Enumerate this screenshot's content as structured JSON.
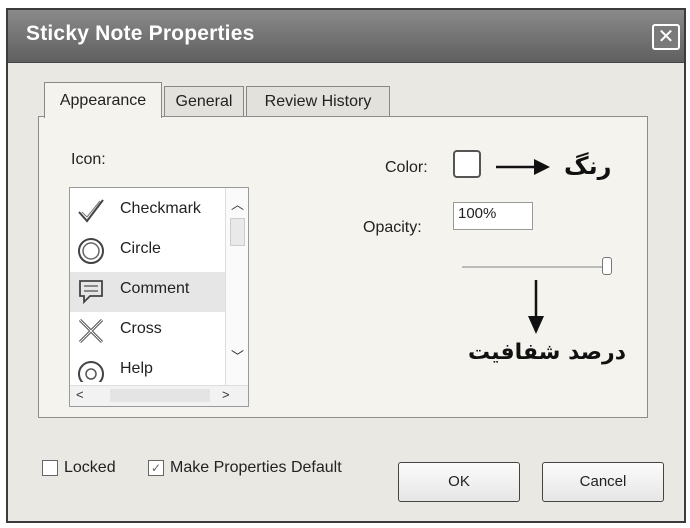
{
  "dialog": {
    "title": "Sticky Note Properties",
    "close_glyph": "✕"
  },
  "tabs": [
    {
      "label": "Appearance",
      "active": true
    },
    {
      "label": "General",
      "active": false
    },
    {
      "label": "Review History",
      "active": false
    }
  ],
  "appearance": {
    "icon_label": "Icon:",
    "icons": [
      {
        "label": "Checkmark",
        "icon": "checkmark-icon",
        "selected": false
      },
      {
        "label": "Circle",
        "icon": "circle-icon",
        "selected": false
      },
      {
        "label": "Comment",
        "icon": "comment-icon",
        "selected": true
      },
      {
        "label": "Cross",
        "icon": "cross-icon",
        "selected": false
      },
      {
        "label": "Help",
        "icon": "help-icon",
        "selected": false
      }
    ],
    "color_label": "Color:",
    "color_value": "#ffffff",
    "opacity_label": "Opacity:",
    "opacity_value": "100%",
    "opacity_slider_fraction": 1.0
  },
  "annotations": {
    "color": "رنگ",
    "opacity": "درصد شفافیت"
  },
  "footer": {
    "locked_label": "Locked",
    "locked_checked": false,
    "make_default_label": "Make Properties Default",
    "make_default_checked": true,
    "ok_label": "OK",
    "cancel_label": "Cancel"
  }
}
